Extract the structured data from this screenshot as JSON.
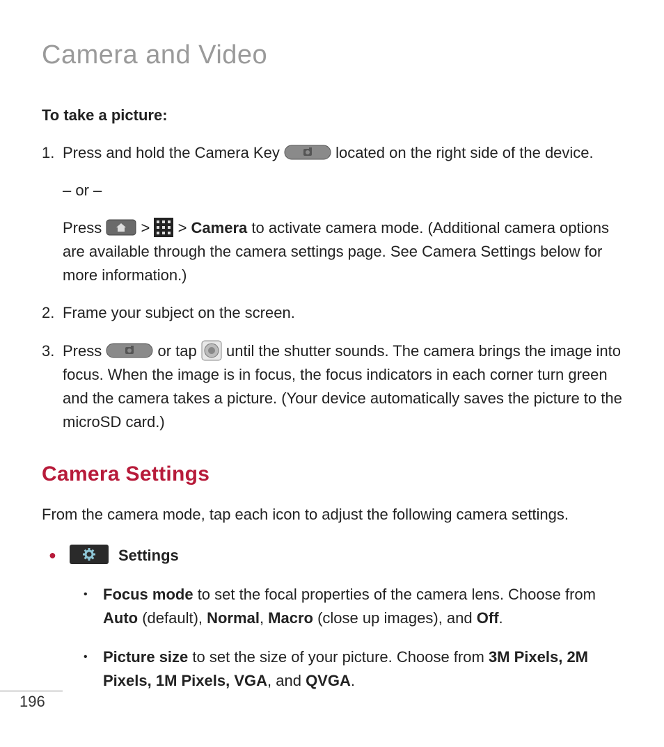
{
  "title": "Camera and Video",
  "subheading": "To take a picture:",
  "step1": {
    "num": "1.",
    "text_a": "Press and hold the Camera Key ",
    "text_b": " located on the right side of the device.",
    "or": "– or –",
    "text_c": "Press ",
    "gt1": " > ",
    "gt2": " > ",
    "camera_label": "Camera",
    "text_d": " to activate camera mode. (Additional camera options are available through the camera settings page. See Camera Settings below for more information.)"
  },
  "step2": {
    "num": "2.",
    "text": "Frame your subject on the screen."
  },
  "step3": {
    "num": "3.",
    "text_a": "Press ",
    "text_b": " or tap ",
    "text_c": " until the shutter sounds. The camera brings the image into focus. When the image is in focus, the focus indicators in each corner turn green and the camera takes a picture. (Your device automatically saves the picture to the microSD card.)"
  },
  "settings_heading": "Camera Settings",
  "settings_intro": "From the camera mode, tap each icon to adjust the following camera settings.",
  "settings_label": "Settings",
  "focus_mode": {
    "bold_a": "Focus mode",
    "text_a": " to set the focal properties of the camera lens. Choose from ",
    "bold_b": "Auto",
    "text_b": " (default), ",
    "bold_c": "Normal",
    "text_c": ", ",
    "bold_d": "Macro",
    "text_d": " (close up images), and ",
    "bold_e": "Off",
    "text_e": "."
  },
  "picture_size": {
    "bold_a": "Picture size",
    "text_a": " to set the size of your picture. Choose from ",
    "bold_b": "3M Pixels, 2M Pixels, 1M Pixels, VGA",
    "text_b": ", and ",
    "bold_c": "QVGA",
    "text_c": "."
  },
  "page_number": "196"
}
